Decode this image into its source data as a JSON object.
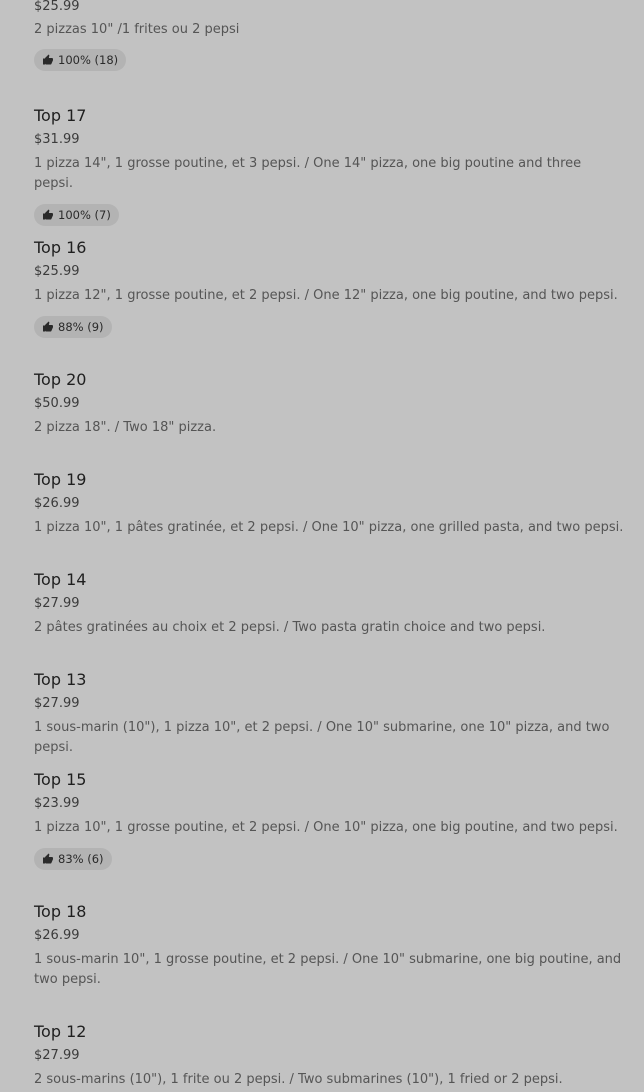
{
  "items": [
    {
      "title": "",
      "price": "$25.99",
      "description": "2 pizzas 10\" /1 frites ou 2 pepsi",
      "rating": "100% (18)"
    },
    {
      "title": "Top 17",
      "price": "$31.99",
      "description": "1 pizza 14\", 1 grosse poutine, et 3 pepsi. / One 14\" pizza, one big poutine and three pepsi.",
      "rating": "100% (7)"
    },
    {
      "title": "Top 16",
      "price": "$25.99",
      "description": "1 pizza 12\", 1 grosse poutine, et 2 pepsi. / One 12\" pizza, one big poutine, and two pepsi.",
      "rating": "88% (9)"
    },
    {
      "title": "Top 20",
      "price": "$50.99",
      "description": "2 pizza 18\". / Two 18\" pizza.",
      "rating": ""
    },
    {
      "title": "Top 19",
      "price": "$26.99",
      "description": "1 pizza 10\", 1 pâtes gratinée, et 2 pepsi. / One 10\" pizza, one grilled pasta, and two pepsi.",
      "rating": ""
    },
    {
      "title": "Top 14",
      "price": "$27.99",
      "description": "2 pâtes gratinées au choix et 2 pepsi. / Two pasta gratin choice and two pepsi.",
      "rating": ""
    },
    {
      "title": "Top 13",
      "price": "$27.99",
      "description": "1 sous-marin (10\"), 1 pizza 10\", et 2 pepsi. / One 10\" submarine, one 10\" pizza, and two pepsi.",
      "rating": ""
    },
    {
      "title": "Top 15",
      "price": "$23.99",
      "description": "1 pizza 10\", 1 grosse poutine, et 2 pepsi. / One 10\" pizza, one big poutine, and two pepsi.",
      "rating": "83% (6)"
    },
    {
      "title": "Top 18",
      "price": "$26.99",
      "description": "1 sous-marin 10\", 1 grosse poutine, et 2 pepsi. / One 10\" submarine, one big poutine, and two pepsi.",
      "rating": ""
    },
    {
      "title": "Top 12",
      "price": "$27.99",
      "description": "2 sous-marins (10\"), 1 frite ou 2 pepsi. / Two submarines (10\"), 1 fried or 2 pepsi.",
      "rating": ""
    }
  ]
}
